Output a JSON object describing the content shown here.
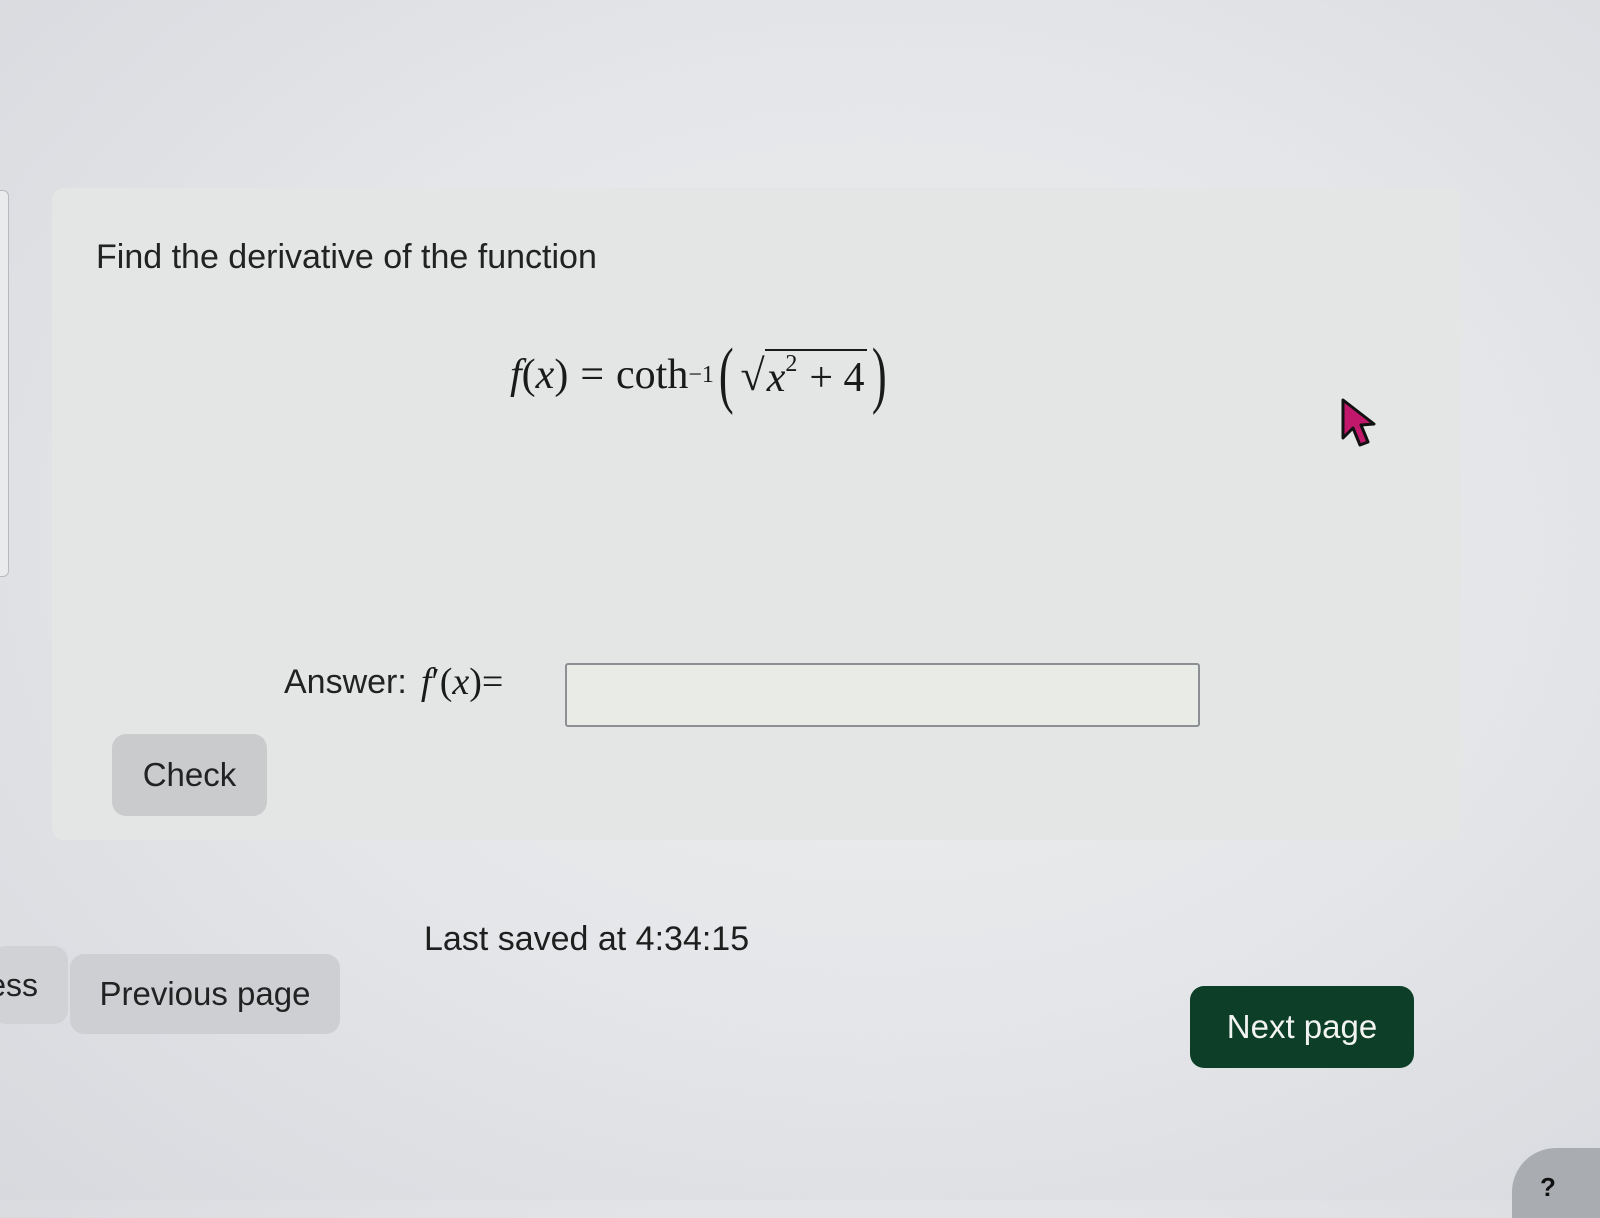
{
  "question": {
    "prompt": "Find the derivative of the function",
    "formula": {
      "lhs_func": "f",
      "lhs_open": "(",
      "lhs_var": "x",
      "lhs_close": ")",
      "equals": "=",
      "func_name": "coth",
      "exponent": "−1",
      "open_paren": "(",
      "sqrt_symbol": "√",
      "radicand_var": "x",
      "radicand_exp": "2",
      "radicand_rest": "+ 4",
      "close_paren": ")"
    },
    "answer_label": "Answer:",
    "answer_func": {
      "name": "f",
      "prime": "′",
      "open": "(",
      "var": "x",
      "close": ")",
      "equals": "="
    },
    "answer_value": "",
    "check_label": "Check"
  },
  "status": {
    "last_saved": "Last saved at 4:34:15"
  },
  "navigation": {
    "progress_label_partial": "ess",
    "previous_label": "Previous page",
    "next_label": "Next page",
    "help_label": "?"
  },
  "colors": {
    "next_button_bg": "#0d3e28",
    "cursor_fill": "#c2186b"
  },
  "icons": {
    "cursor": "mouse-pointer-icon"
  }
}
